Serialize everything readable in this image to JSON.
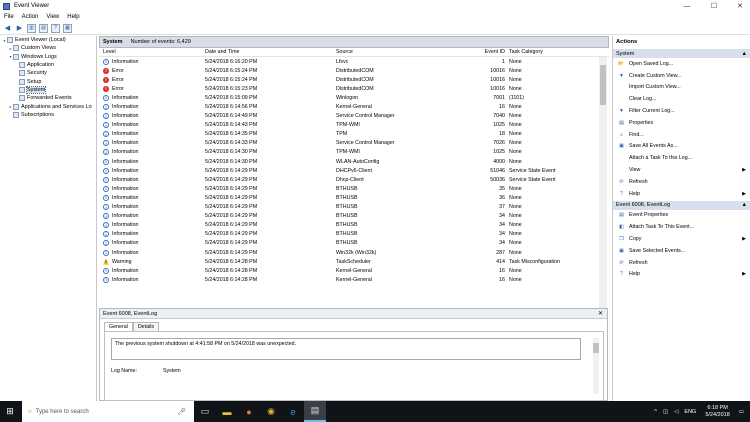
{
  "window": {
    "title": "Event Viewer",
    "controls": [
      "—",
      "☐",
      "✕"
    ]
  },
  "menu": [
    "File",
    "Action",
    "View",
    "Help"
  ],
  "tree": [
    {
      "label": "Event Viewer (Local)",
      "indent": 0,
      "expander": "▾"
    },
    {
      "label": "Custom Views",
      "indent": 1,
      "expander": "▸"
    },
    {
      "label": "Windows Logs",
      "indent": 1,
      "expander": "▾"
    },
    {
      "label": "Application",
      "indent": 2,
      "expander": ""
    },
    {
      "label": "Security",
      "indent": 2,
      "expander": ""
    },
    {
      "label": "Setup",
      "indent": 2,
      "expander": ""
    },
    {
      "label": "System",
      "indent": 2,
      "expander": "",
      "selected": true
    },
    {
      "label": "Forwarded Events",
      "indent": 2,
      "expander": ""
    },
    {
      "label": "Applications and Services Lo",
      "indent": 1,
      "expander": "▸"
    },
    {
      "label": "Subscriptions",
      "indent": 1,
      "expander": ""
    }
  ],
  "list": {
    "name": "System",
    "count_text": "Number of events: 6,429",
    "columns": [
      "Level",
      "Date and Time",
      "Source",
      "Event ID",
      "Task Category"
    ],
    "rows": [
      [
        "info",
        "Information",
        "5/24/2018 6:16:20 PM",
        "Lfsvc",
        "1",
        "None"
      ],
      [
        "err",
        "Error",
        "5/24/2018 6:15:24 PM",
        "DistributedCOM",
        "10016",
        "None"
      ],
      [
        "err",
        "Error",
        "5/24/2018 6:15:24 PM",
        "DistributedCOM",
        "10016",
        "None"
      ],
      [
        "err",
        "Error",
        "5/24/2018 6:15:23 PM",
        "DistributedCOM",
        "10016",
        "None"
      ],
      [
        "info",
        "Information",
        "5/24/2018 6:15:09 PM",
        "Winlogon",
        "7001",
        "(1101)"
      ],
      [
        "info",
        "Information",
        "5/24/2018 6:14:56 PM",
        "Kernel-General",
        "16",
        "None"
      ],
      [
        "info",
        "Information",
        "5/24/2018 6:14:49 PM",
        "Service Control Manager",
        "7040",
        "None"
      ],
      [
        "info",
        "Information",
        "5/24/2018 6:14:43 PM",
        "TPM-WMI",
        "1025",
        "None"
      ],
      [
        "info",
        "Information",
        "5/24/2018 6:14:35 PM",
        "TPM",
        "18",
        "None"
      ],
      [
        "info",
        "Information",
        "5/24/2018 6:14:33 PM",
        "Service Control Manager",
        "7026",
        "None"
      ],
      [
        "info",
        "Information",
        "5/24/2018 6:14:30 PM",
        "TPM-WMI",
        "1025",
        "None"
      ],
      [
        "info",
        "Information",
        "5/24/2018 6:14:30 PM",
        "WLAN-AutoConfig",
        "4000",
        "None"
      ],
      [
        "info",
        "Information",
        "5/24/2018 6:14:29 PM",
        "DHCPv6-Client",
        "51046",
        "Service State Event"
      ],
      [
        "info",
        "Information",
        "5/24/2018 6:14:29 PM",
        "Dhcp-Client",
        "50036",
        "Service State Event"
      ],
      [
        "info",
        "Information",
        "5/24/2018 6:14:29 PM",
        "BTHUSB",
        "35",
        "None"
      ],
      [
        "info",
        "Information",
        "5/24/2018 6:14:29 PM",
        "BTHUSB",
        "36",
        "None"
      ],
      [
        "info",
        "Information",
        "5/24/2018 6:14:29 PM",
        "BTHUSB",
        "37",
        "None"
      ],
      [
        "info",
        "Information",
        "5/24/2018 6:14:29 PM",
        "BTHUSB",
        "34",
        "None"
      ],
      [
        "info",
        "Information",
        "5/24/2018 6:14:29 PM",
        "BTHUSB",
        "34",
        "None"
      ],
      [
        "info",
        "Information",
        "5/24/2018 6:14:29 PM",
        "BTHUSB",
        "34",
        "None"
      ],
      [
        "info",
        "Information",
        "5/24/2018 6:14:29 PM",
        "BTHUSB",
        "34",
        "None"
      ],
      [
        "info",
        "Information",
        "5/24/2018 6:14:29 PM",
        "Win32k (Win32k)",
        "287",
        "None"
      ],
      [
        "warn",
        "Warning",
        "5/24/2018 6:14:28 PM",
        "TaskScheduler",
        "414",
        "Task Misconfiguration"
      ],
      [
        "info",
        "Information",
        "5/24/2018 6:14:28 PM",
        "Kernel-General",
        "16",
        "None"
      ],
      [
        "info",
        "Information",
        "5/24/2018 6:14:28 PM",
        "Kernel-General",
        "16",
        "None"
      ]
    ]
  },
  "details": {
    "title": "Event 6008, EventLog",
    "tabs": [
      "General",
      "Details"
    ],
    "message": "The previous system shutdown at 4:41:58 PM on 5/24/2018 was unexpected.",
    "log_name_label": "Log Name:",
    "log_name_value": "System"
  },
  "actions": {
    "title": "Actions",
    "section1": "System",
    "section1_items": [
      {
        "label": "Open Saved Log...",
        "icon": "folder-icon",
        "glyph": "📂",
        "arrow": ""
      },
      {
        "label": "Create Custom View...",
        "icon": "filter-icon",
        "glyph": "▼",
        "arrow": ""
      },
      {
        "label": "Import Custom View...",
        "icon": "blank-icon",
        "glyph": "",
        "arrow": ""
      },
      {
        "label": "Clear Log...",
        "icon": "blank-icon",
        "glyph": "",
        "arrow": ""
      },
      {
        "label": "Filter Current Log...",
        "icon": "filter-icon",
        "glyph": "▼",
        "arrow": ""
      },
      {
        "label": "Properties",
        "icon": "properties-icon",
        "glyph": "▤",
        "arrow": ""
      },
      {
        "label": "Find...",
        "icon": "find-icon",
        "glyph": "⌕",
        "arrow": ""
      },
      {
        "label": "Save All Events As...",
        "icon": "save-icon",
        "glyph": "▣",
        "arrow": ""
      },
      {
        "label": "Attach a Task To this Log...",
        "icon": "blank-icon",
        "glyph": "",
        "arrow": ""
      },
      {
        "label": "View",
        "icon": "blank-icon",
        "glyph": "",
        "arrow": "▶"
      },
      {
        "label": "Refresh",
        "icon": "refresh-icon",
        "glyph": "⟳",
        "arrow": ""
      },
      {
        "label": "Help",
        "icon": "help-icon",
        "glyph": "?",
        "arrow": "▶"
      }
    ],
    "section2": "Event 6008, EventLog",
    "section2_items": [
      {
        "label": "Event Properties",
        "icon": "properties-icon",
        "glyph": "▤",
        "arrow": ""
      },
      {
        "label": "Attach Task To This Event...",
        "icon": "task-icon",
        "glyph": "◧",
        "arrow": ""
      },
      {
        "label": "Copy",
        "icon": "copy-icon",
        "glyph": "❐",
        "arrow": "▶"
      },
      {
        "label": "Save Selected Events...",
        "icon": "save-icon",
        "glyph": "▣",
        "arrow": ""
      },
      {
        "label": "Refresh",
        "icon": "refresh-icon",
        "glyph": "⟳",
        "arrow": ""
      },
      {
        "label": "Help",
        "icon": "help-icon",
        "glyph": "?",
        "arrow": "▶"
      }
    ]
  },
  "taskbar": {
    "search_placeholder": "Type here to search",
    "language": "ENG",
    "time": "6:18 PM",
    "date": "5/24/2018"
  }
}
